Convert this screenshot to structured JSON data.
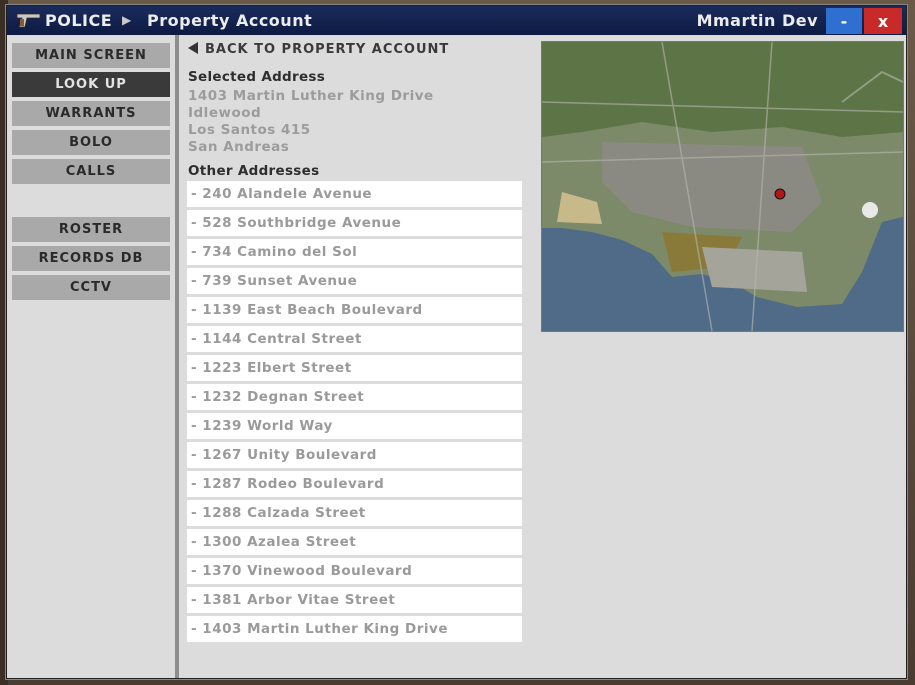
{
  "title": {
    "app": "POLICE",
    "separator": "▶",
    "page": "Property Account",
    "user": "Mmartin Dev",
    "minimize": "-",
    "close": "x"
  },
  "sidebar": {
    "items": [
      {
        "label": "MAIN SCREEN",
        "active": false
      },
      {
        "label": "LOOK UP",
        "active": true
      },
      {
        "label": "WARRANTS",
        "active": false
      },
      {
        "label": "BOLO",
        "active": false
      },
      {
        "label": "CALLS",
        "active": false
      },
      {
        "label": "ROSTER",
        "active": false
      },
      {
        "label": "RECORDS DB",
        "active": false
      },
      {
        "label": "CCTV",
        "active": false
      }
    ]
  },
  "main": {
    "back_label": "BACK TO PROPERTY ACCOUNT",
    "selected_title": "Selected Address",
    "selected": {
      "street": "1403 Martin Luther King Drive",
      "district": "Idlewood",
      "city_zip": "Los Santos 415",
      "state": "San Andreas"
    },
    "other_title": "Other Addresses",
    "other_addresses": [
      "- 240 Alandele Avenue",
      "- 528 Southbridge Avenue",
      "- 734 Camino del Sol",
      "- 739 Sunset Avenue",
      "- 1139 East Beach Boulevard",
      "- 1144 Central Street",
      "- 1223 Elbert Street",
      "- 1232 Degnan Street",
      "- 1239 World Way",
      "- 1267 Unity Boulevard",
      "- 1287 Rodeo Boulevard",
      "- 1288 Calzada Street",
      "- 1300 Azalea Street",
      "- 1370 Vinewood Boulevard",
      "- 1381 Arbor Vitae Street",
      "- 1403 Martin Luther King Drive"
    ]
  },
  "colors": {
    "titlebar": "#0d1a42",
    "minimize": "#2f6fd0",
    "close": "#c82a2a",
    "nav_active": "#3a3a3a",
    "nav_inactive": "#a9a9a9"
  }
}
